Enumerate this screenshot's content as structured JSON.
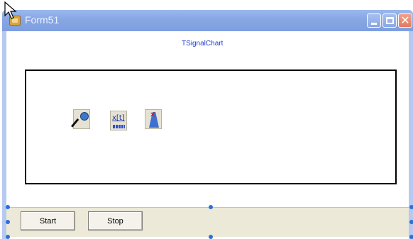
{
  "window": {
    "title": "Form51",
    "titlebar_color": "#87a6e3",
    "icons": {
      "app": "form-app-icon",
      "minimize": "minimize-icon",
      "maximize": "maximize-icon",
      "close": "close-icon"
    },
    "close_glyph": "✕"
  },
  "chart": {
    "title": "TSignalChart",
    "title_color": "#1f3fd8"
  },
  "components": [
    {
      "icon": "microphone-icon"
    },
    {
      "icon": "signal-x-t-icon",
      "label": "x[t]"
    },
    {
      "icon": "metronome-icon"
    }
  ],
  "toolbar": {
    "start_label": "Start",
    "stop_label": "Stop"
  }
}
